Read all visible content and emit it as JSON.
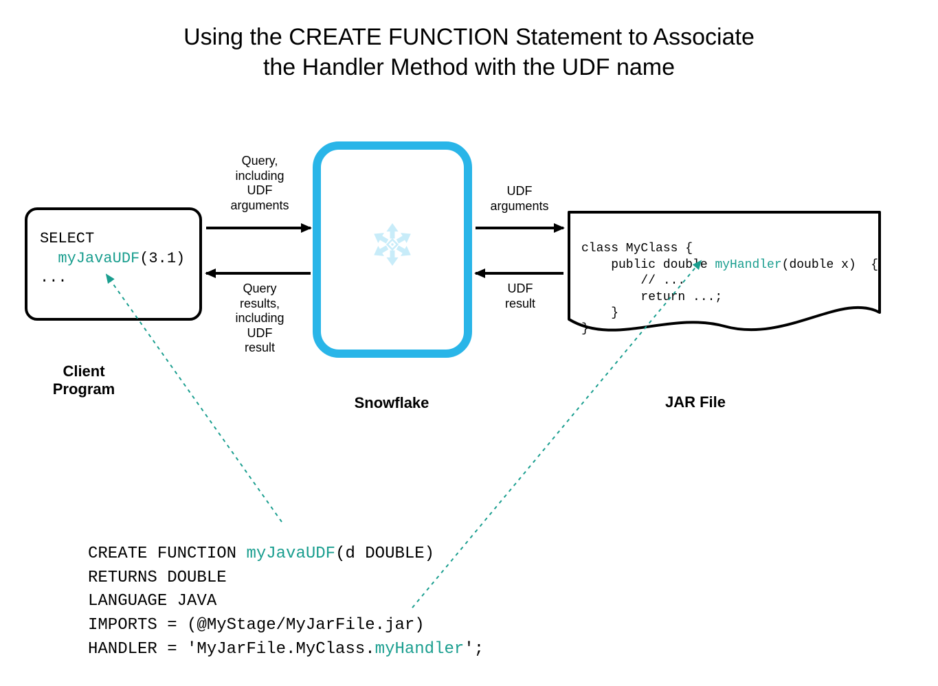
{
  "title": {
    "line1": "Using the CREATE FUNCTION Statement to Associate",
    "line2": "the Handler Method with the UDF name"
  },
  "client": {
    "line1": "SELECT",
    "udf_name": "myJavaUDF",
    "call_suffix": "(3.1)",
    "line3": "  ...",
    "caption": "Client\nProgram"
  },
  "snowflake": {
    "caption": "Snowflake"
  },
  "jar": {
    "caption": "JAR File",
    "code": {
      "l1": "class MyClass {",
      "l2": "    public double ",
      "handler": "myHandler",
      "l2b": "(double x)  {",
      "l3": "        // ...",
      "l4": "        return ...;",
      "l5": "    }",
      "l6": "}"
    }
  },
  "arrows": {
    "client_to_sf": "Query,\nincluding\nUDF\narguments",
    "sf_to_client": "Query\nresults,\nincluding\nUDF\nresult",
    "sf_to_jar": "UDF\narguments",
    "jar_to_sf": "UDF\nresult"
  },
  "create_function": {
    "l1a": "CREATE FUNCTION ",
    "fn": "myJavaUDF",
    "l1b": "(d DOUBLE)",
    "l2": "RETURNS DOUBLE",
    "l3": "LANGUAGE JAVA",
    "l4": "IMPORTS = (@MyStage/MyJarFile.jar)",
    "l5a": "HANDLER = 'MyJarFile.MyClass.",
    "handler": "myHandler",
    "l5b": "';"
  },
  "colors": {
    "teal": "#1a9e8f",
    "snowflake_blue": "#29b5e8"
  }
}
